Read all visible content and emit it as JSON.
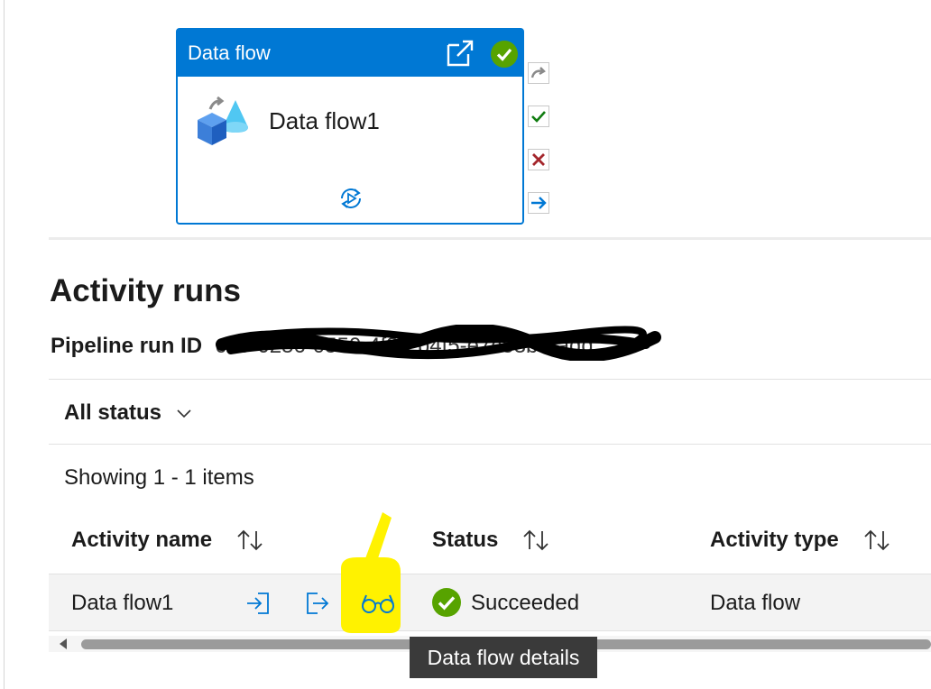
{
  "card": {
    "header_title": "Data flow",
    "name": "Data flow1"
  },
  "activity_runs": {
    "title": "Activity runs",
    "pipeline_run_label": "Pipeline run ID",
    "pipeline_run_value": "cd5-0256-0550-4f26-b4f5-e7c53beradd",
    "status_filter": "All status",
    "showing": "Showing 1 - 1 items",
    "columns": {
      "activity_name": "Activity name",
      "status": "Status",
      "activity_type": "Activity type"
    },
    "rows": [
      {
        "activity_name": "Data flow1",
        "status": "Succeeded",
        "activity_type": "Data flow"
      }
    ]
  },
  "tooltip": "Data flow details",
  "colors": {
    "accent": "#0078d4",
    "success": "#57a300",
    "fail": "#a4262c",
    "highlight": "#fff200"
  },
  "icons": [
    "external-link-icon",
    "success-check-icon",
    "data-flow-icon",
    "rerun-icon",
    "redo-icon",
    "check-icon",
    "close-icon",
    "arrow-right-icon",
    "input-icon",
    "output-icon",
    "glasses-icon",
    "sort-icon",
    "chevron-down-icon"
  ]
}
